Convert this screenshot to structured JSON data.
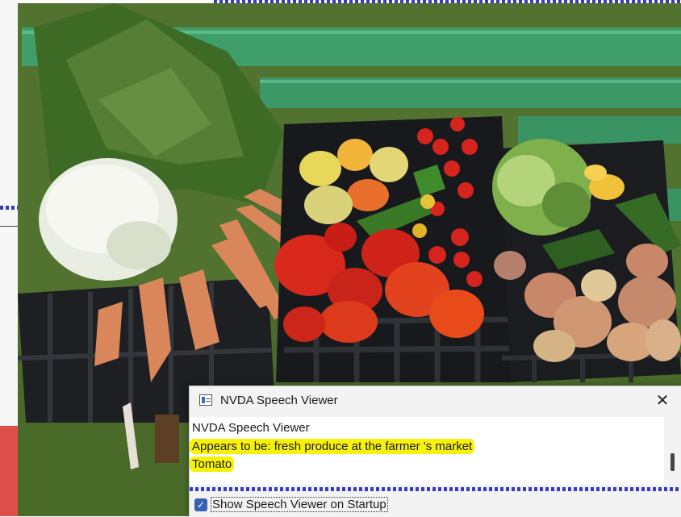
{
  "window": {
    "title": "NVDA Speech Viewer",
    "close_glyph": "✕"
  },
  "speech": {
    "lines": [
      {
        "text": "NVDA Speech Viewer",
        "highlighted": false
      },
      {
        "text": "Appears to be: fresh produce at the farmer 's market",
        "highlighted": true
      },
      {
        "text": "Tomato",
        "highlighted": true
      }
    ],
    "highlight_color": "#f8f10a"
  },
  "options": {
    "show_on_startup_label": "Show Speech Viewer on Startup",
    "show_on_startup_checked": true,
    "checkbox_glyph": "✓"
  },
  "colors": {
    "accent": "#3660b4",
    "focus_dots": "#3a3ac8",
    "side_panel_red": "#dd4f4a"
  },
  "icons": [
    "speech-viewer-app-icon",
    "close-icon",
    "check-icon"
  ]
}
